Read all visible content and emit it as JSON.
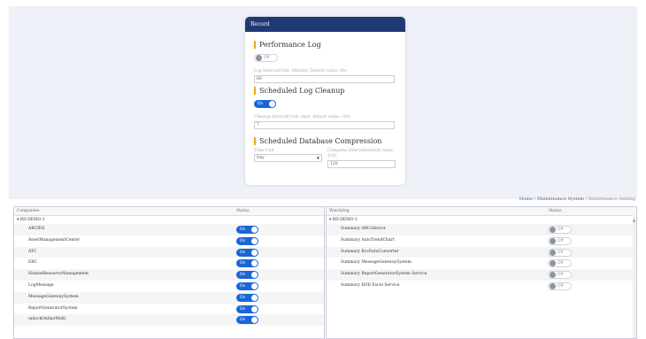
{
  "record_card": {
    "title": "Record",
    "performance_log": {
      "title": "Performance Log",
      "toggle_label": "Off",
      "hint": "Log Interval(Unit: Minute), Default value: 60s",
      "value": "60"
    },
    "log_cleanup": {
      "title": "Scheduled Log Cleanup",
      "toggle_label": "On",
      "hint": "Cleanup Interval(Unit: days, default value: 180)",
      "value": "7"
    },
    "db_compression": {
      "title": "Scheduled Database Compression",
      "time_unit_label": "Time Unit",
      "time_unit_value": "Day",
      "interval_label": "Compress Interval(default value: 120)",
      "interval_value": "120"
    }
  },
  "breadcrumb": {
    "home": "Home",
    "sep": "/",
    "system": "Maintenance System",
    "current": "Maintenance Setting"
  },
  "companies_table": {
    "col_name": "Companies",
    "col_status": "Status",
    "group": "▾ RD-DEMO-1",
    "rows": [
      {
        "name": "ARCIDS",
        "status": "On"
      },
      {
        "name": "AssetManagementCenter",
        "status": "On"
      },
      {
        "name": "ATC",
        "status": "On"
      },
      {
        "name": "ERC",
        "status": "On"
      },
      {
        "name": "HumanResourceManagement",
        "status": "On"
      },
      {
        "name": "LogMessage",
        "status": "On"
      },
      {
        "name": "MessageGatewaySystem",
        "status": "On"
      },
      {
        "name": "ReportGeneratorSystem",
        "status": "On"
      },
      {
        "name": "unlockOnlineMulti",
        "status": "On"
      }
    ]
  },
  "watchdog_table": {
    "col_name": "Watchdog",
    "col_status": "Status",
    "group": "▾ RD-DEMO-1",
    "rows": [
      {
        "name": "Summary ARCollector",
        "status": "Off"
      },
      {
        "name": "Summary AutoTrendChart",
        "status": "Off"
      },
      {
        "name": "Summary RcvDataConverter",
        "status": "Off"
      },
      {
        "name": "Summary MessageGatewaySystem",
        "status": "Off"
      },
      {
        "name": "Summary ReportGeneratorSystem Service",
        "status": "Off"
      },
      {
        "name": "Summary ROD Excel Service",
        "status": "Off"
      }
    ]
  }
}
